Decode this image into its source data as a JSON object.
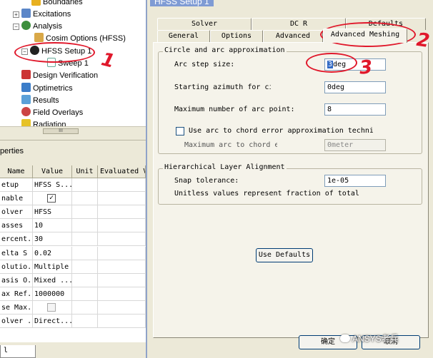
{
  "tree": {
    "items": [
      {
        "label": "Boundaries"
      },
      {
        "label": "Excitations"
      },
      {
        "label": "Analysis"
      },
      {
        "label": "Cosim Options (HFSS)"
      },
      {
        "label": "HFSS Setup 1"
      },
      {
        "label": "Sweep 1"
      },
      {
        "label": "Design Verification"
      },
      {
        "label": "Optimetrics"
      },
      {
        "label": "Results"
      },
      {
        "label": "Field Overlays"
      },
      {
        "label": "Radiation"
      }
    ],
    "scroll_grip": "III"
  },
  "properties": {
    "header": "perties",
    "columns": [
      "Name",
      "Value",
      "Unit",
      "Evaluated Va"
    ],
    "rows": [
      {
        "name": "etup",
        "value": "HFSS S..."
      },
      {
        "name": "nable",
        "value": "",
        "checkbox": true,
        "checked": true
      },
      {
        "name": "olver",
        "value": "HFSS"
      },
      {
        "name": "asses",
        "value": "10"
      },
      {
        "name": "ercent...",
        "value": "30"
      },
      {
        "name": "elta S",
        "value": "0.02"
      },
      {
        "name": "olutio...",
        "value": "Multiple"
      },
      {
        "name": "asis O...",
        "value": "Mixed ..."
      },
      {
        "name": "ax Ref...",
        "value": "1000000"
      },
      {
        "name": "se Max...",
        "value": "",
        "checkbox": true,
        "checked": false
      },
      {
        "name": "olver ...",
        "value": "Direct..."
      }
    ],
    "tab_label": "l Design",
    "check_mark": "✓"
  },
  "dialog": {
    "title": "HFSS Setup 1",
    "tabs_back": [
      "Solver",
      "DC R",
      "Defaults"
    ],
    "tabs_front": [
      "General",
      "Options",
      "Advanced",
      "Advanced Meshing"
    ],
    "circle": {
      "title": "Circle and arc approximation",
      "arc_step_label": "Arc step size:",
      "arc_step_value": "3deg",
      "start_azimuth_label": "Starting azimuth for cir",
      "start_azimuth_value": "0deg",
      "max_points_label": "Maximum number of arc point:",
      "max_points_value": "8",
      "chord_check_label": "Use arc to chord error approximation technique fo",
      "max_chord_label": "Maximum arc to chord err",
      "max_chord_value": "0meter"
    },
    "hierarchical": {
      "title": "Hierarchical Layer Alignment",
      "snap_label": "Snap tolerance:",
      "snap_value": "1e-05",
      "note": "Unitless values represent fraction of total"
    },
    "use_defaults_label": "Use Defaults",
    "ok_label": "确定",
    "cancel_label": "取消"
  },
  "annotations": {
    "one": "1",
    "two": "2",
    "three": "3"
  },
  "watermark": "ANSYS老兵",
  "colors": {
    "annotation": "#e0182b",
    "selection": "#316ac5",
    "dialog_bg": "#ece9d8"
  }
}
